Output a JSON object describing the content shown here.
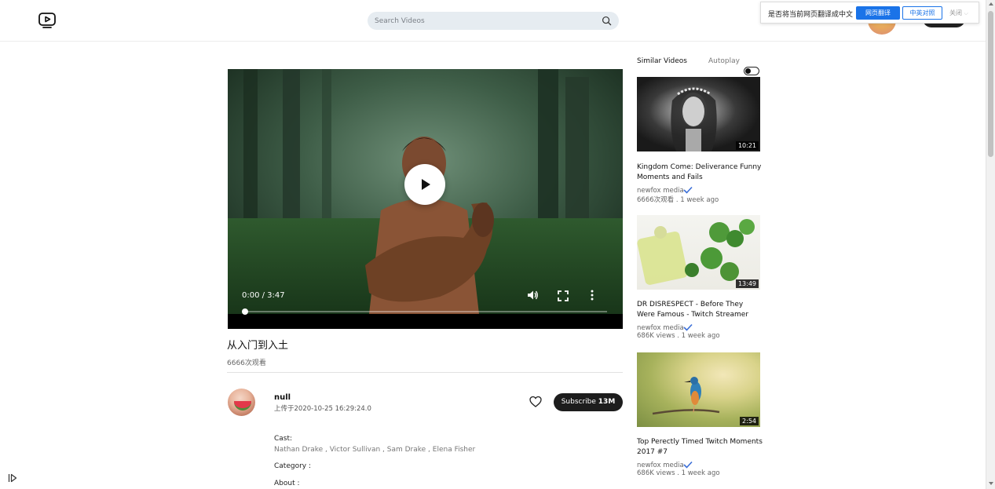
{
  "search": {
    "placeholder": "Search Videos"
  },
  "translate_bar": {
    "question": "是否将当前网页翻译成中文",
    "translate_button": "网页翻译",
    "compare_button": "中英对照",
    "close_label": "关闭"
  },
  "player": {
    "time_display": "0:00 / 3:47",
    "progress_fraction": 0
  },
  "video": {
    "title": "从入门到入土",
    "views": "6666次观看"
  },
  "channel": {
    "name": "null",
    "upload_date": "上传于2020-10-25 16:29:24.0",
    "subscribe_label": "Subscribe",
    "subscriber_count": "13M"
  },
  "details": {
    "cast_label": "Cast:",
    "cast": "Nathan Drake ,  Victor Sullivan ,  Sam Drake ,  Elena Fisher",
    "category_label": "Category :",
    "about_label": "About :"
  },
  "similar": {
    "header": "Similar Videos",
    "autoplay_label": "Autoplay",
    "autoplay_on": false,
    "items": [
      {
        "duration": "10:21",
        "title": "Kingdom Come: Deliverance Funny Moments and Fails",
        "channel": "newfox media",
        "meta": "6666次观看 . 1 week ago"
      },
      {
        "duration": "13:49",
        "title": "DR DISRESPECT - Before They Were Famous - Twitch Streamer",
        "channel": "newfox media",
        "meta": "686K views . 1 week ago"
      },
      {
        "duration": "2:54",
        "title": "Top Perectly Timed Twitch Moments 2017 #7",
        "channel": "newfox media",
        "meta": "686K views . 1 week ago"
      }
    ]
  },
  "colors": {
    "accent_blue": "#1a73e8",
    "verified_blue": "#3b6fd8",
    "subscribe_bg": "#1d1d1d"
  },
  "icons": [
    "tv-play-logo-icon",
    "search-icon",
    "play-icon",
    "volume-icon",
    "fullscreen-icon",
    "more-vertical-icon",
    "heart-icon",
    "verified-check-icon",
    "sidebar-toggle-icon"
  ]
}
